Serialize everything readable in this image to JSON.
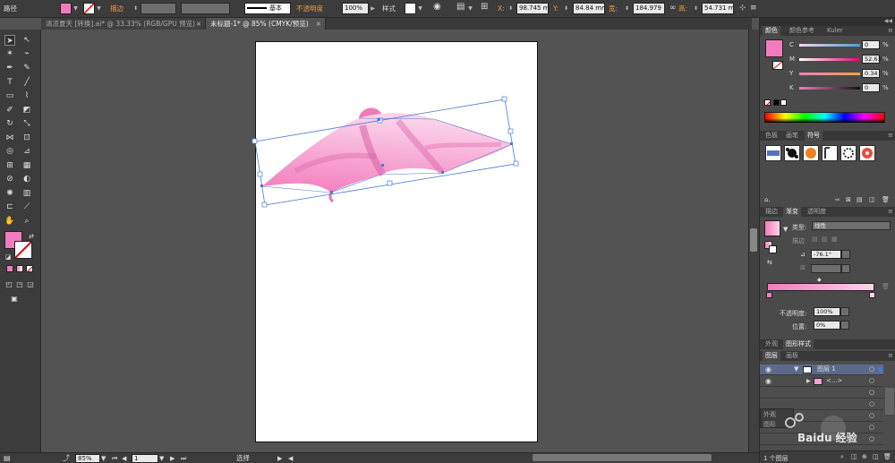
{
  "control_bar": {
    "selection_label": "路径",
    "stroke_label": "描边",
    "stroke_style": "基本",
    "opacity_label": "不透明度",
    "opacity_value": "100%",
    "style_label": "样式",
    "x_label": "X:",
    "x_value": "98.745 mm",
    "y_label": "Y:",
    "y_value": "84.84 mm",
    "w_label": "宽:",
    "w_value": "184.979",
    "h_label": "高:",
    "h_value": "54.731 m",
    "fill_color": "#f27bbd"
  },
  "tabs": [
    {
      "label": "清凉夏天 [转换].ai* @ 33.33% (RGB/GPU 预览)",
      "close": "×"
    },
    {
      "label": "未标题-1* @ 85% (CMYK/预览)",
      "close": "×"
    }
  ],
  "status": {
    "zoom": "85%",
    "page": "1",
    "tool": "选择"
  },
  "color_panel": {
    "tabs": [
      "颜色",
      "颜色参考",
      "Kuler"
    ],
    "channels": [
      {
        "label": "C",
        "value": "0",
        "unit": "%"
      },
      {
        "label": "M",
        "value": "52.63",
        "unit": "%"
      },
      {
        "label": "Y",
        "value": "0.34",
        "unit": "%"
      },
      {
        "label": "K",
        "value": "0",
        "unit": "%"
      }
    ],
    "swatch": "#f27bbd"
  },
  "symbols_panel": {
    "tabs": [
      "色板",
      "画笔",
      "符号"
    ]
  },
  "gradient_panel": {
    "tabs": [
      "描边",
      "渐变",
      "透明度"
    ],
    "type_label": "类型:",
    "type_value": "线性",
    "stroke_label": "描边",
    "angle_value": "-76.1°",
    "opacity_label": "不透明度:",
    "opacity_value": "100%",
    "location_label": "位置:",
    "location_value": "0%",
    "start_color": "#f27bbd",
    "end_color": "#fbd3e9"
  },
  "appearance_panel": {
    "tabs": [
      "外观",
      "图形样式"
    ]
  },
  "layers_panel": {
    "tabs": [
      "图层",
      "画板"
    ],
    "rows": [
      {
        "name": "图层 1"
      },
      {
        "name": "<...>"
      }
    ],
    "footer": "1 个图层"
  },
  "overlay_panel": {
    "tabs": [
      "外观",
      "图形"
    ]
  },
  "watermark": "Baidu 经验"
}
